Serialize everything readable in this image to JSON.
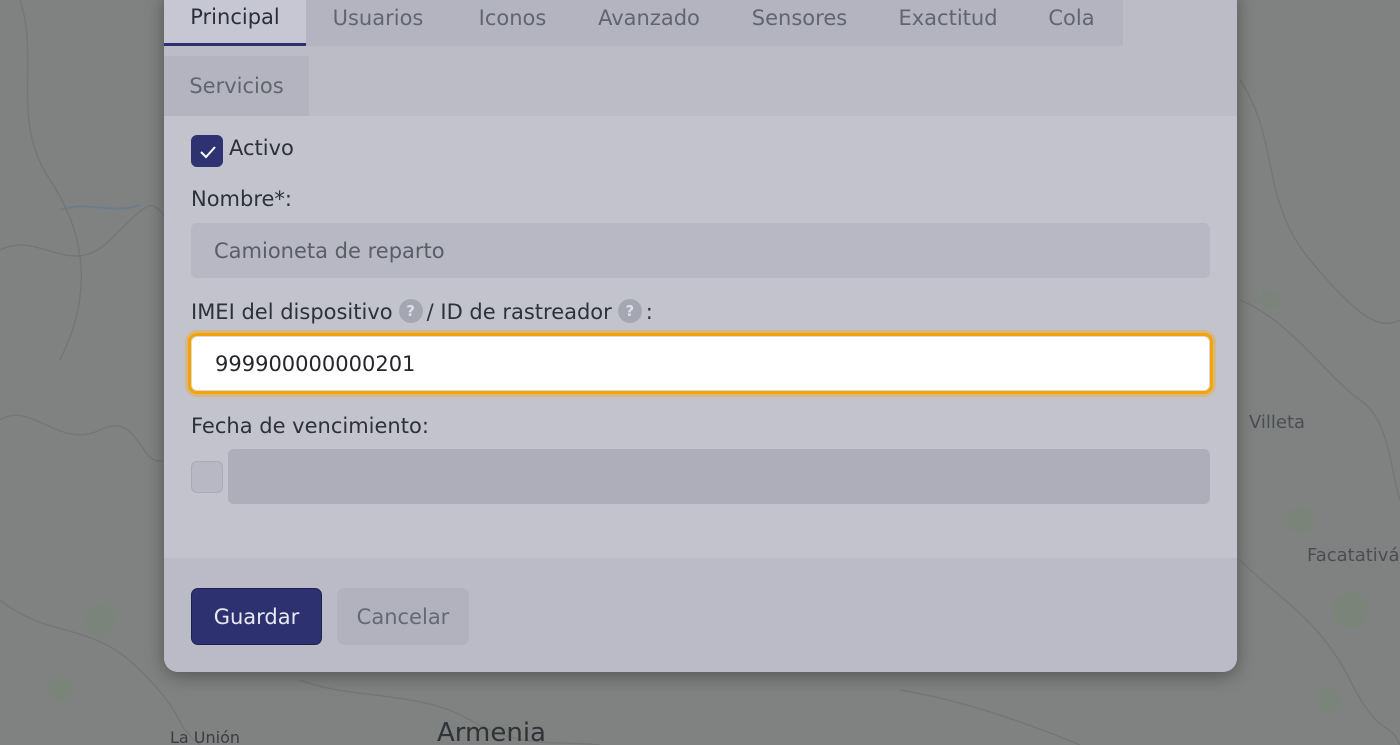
{
  "map": {
    "labels": {
      "villeta": "Villeta",
      "facatativa": "Facatativá",
      "armenia": "Armenia",
      "la_union": "La Unión"
    }
  },
  "modal": {
    "tabs": [
      "Principal",
      "Usuarios",
      "Iconos",
      "Avanzado",
      "Sensores",
      "Exactitud",
      "Cola",
      "Servicios"
    ],
    "active_tab": "Principal",
    "form": {
      "active_label": "Activo",
      "active_checked": true,
      "name_label": "Nombre*:",
      "name_value": "Camioneta de reparto",
      "imei_label": "IMEI del dispositivo",
      "tracker_label": "/ ID de rastreador",
      "help_glyph": "?",
      "colon": ":",
      "imei_value": "999900000000201",
      "expiry_label": "Fecha de vencimiento:",
      "expiry_checked": false,
      "expiry_value": ""
    },
    "buttons": {
      "save": "Guardar",
      "cancel": "Cancelar"
    }
  },
  "colors": {
    "primary": "#2d3170",
    "focus_ring": "#f5a300"
  }
}
